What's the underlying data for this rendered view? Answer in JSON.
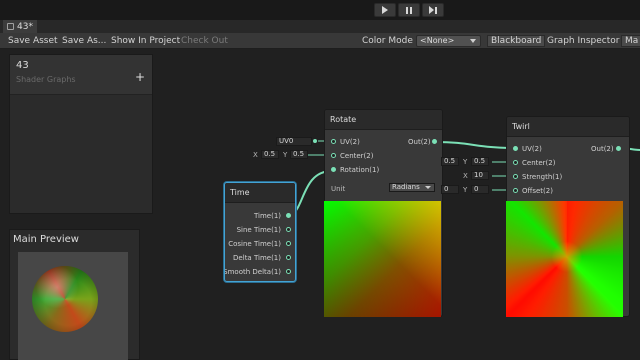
{
  "window": {
    "tab_title": "43*"
  },
  "toolbar": {
    "save_asset": "Save Asset",
    "save_as": "Save As...",
    "show_in_project": "Show In Project",
    "check_out": "Check Out",
    "color_mode_label": "Color Mode",
    "color_mode_value": "<None>",
    "blackboard": "Blackboard",
    "graph_inspector": "Graph Inspector",
    "main_preview_cut": "Ma"
  },
  "blackboard": {
    "title": "43",
    "subtitle": "Shader Graphs",
    "add": "+"
  },
  "preview": {
    "title": "Main Preview"
  },
  "time_node": {
    "title": "Time",
    "outputs": [
      "Time(1)",
      "Sine Time(1)",
      "Cosine Time(1)",
      "Delta Time(1)",
      "Smooth Delta(1)"
    ]
  },
  "rotate_node": {
    "title": "Rotate",
    "uv_field": "UV0",
    "inputs": [
      "UV(2)",
      "Center(2)",
      "Rotation(1)"
    ],
    "output": "Out(2)",
    "center_x_label": "X",
    "center_x": "0.5",
    "center_y_label": "Y",
    "center_y": "0.5",
    "unit_label": "Unit",
    "unit_value": "Radians"
  },
  "twirl_node": {
    "title": "Twirl",
    "inputs": [
      "UV(2)",
      "Center(2)",
      "Strength(1)",
      "Offset(2)"
    ],
    "output": "Out(2)",
    "center_x": "0.5",
    "center_y_label": "Y",
    "center_y": "0.5",
    "strength_label": "X",
    "strength": "10",
    "offset_x": "0",
    "offset_y_label": "Y",
    "offset_y": "0"
  },
  "colors": {
    "accent": "#44a3d4",
    "port": "#7be0b6",
    "background": "#202020"
  },
  "icons": [
    "play-icon",
    "pause-icon",
    "step-icon",
    "shader-graph-tab-icon",
    "add-icon",
    "dropdown-caret-icon"
  ]
}
